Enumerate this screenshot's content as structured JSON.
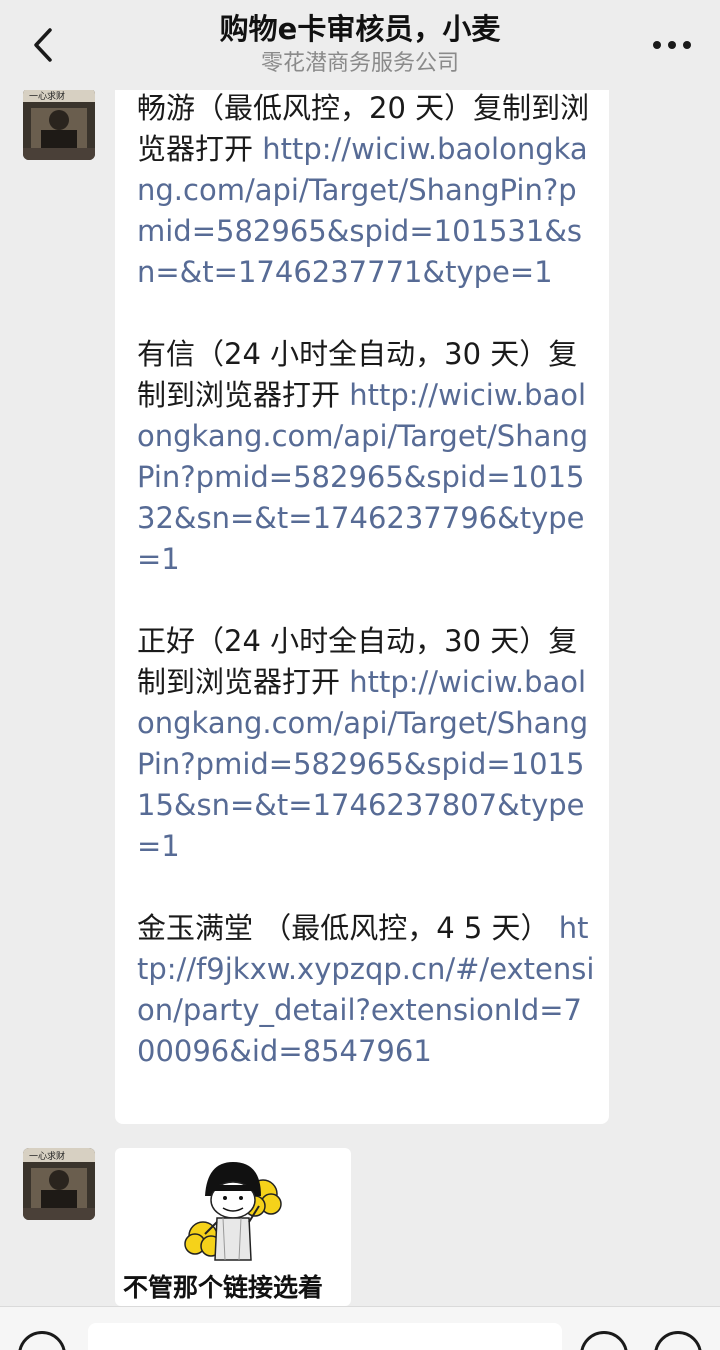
{
  "header": {
    "title": "购物e卡审核员，小麦",
    "subtitle": "零花潜商务服务公司",
    "back_icon": "chevron-left-icon",
    "more_icon": "more-dots-icon"
  },
  "messages": [
    {
      "sender_avatar": "avatar",
      "paragraphs": [
        {
          "text": "畅游（最低风控，20 天）复制到浏览器打开",
          "link": "http://wiciw.baolongkang.com/api/Target/ShangPin?pmid=582965&spid=101531&sn=&t=1746237771&type=1"
        },
        {
          "text": "有信（24 小时全自动，30 天）复制到浏览器打开",
          "link": "http://wiciw.baolongkang.com/api/Target/ShangPin?pmid=582965&spid=101532&sn=&t=1746237796&type=1"
        },
        {
          "text": "正好（24 小时全自动，30 天）复制到浏览器打开",
          "link": "http://wiciw.baolongkang.com/api/Target/ShangPin?pmid=582965&spid=101515&sn=&t=1746237807&type=1"
        },
        {
          "text": "金玉满堂 （最低风控，4 5 天）",
          "link": "http://f9jkxw.xypzqp.cn/#/extension/party_detail?extensionId=700096&id=8547961"
        }
      ]
    },
    {
      "sender_avatar": "avatar",
      "sticker_caption": "不管那个链接选着"
    }
  ],
  "input_bar": {
    "voice_icon": "voice-icon",
    "emoji_icon": "emoji-icon",
    "plus_icon": "plus-icon"
  },
  "colors": {
    "background": "#ededed",
    "bubble": "#ffffff",
    "link": "#576b95",
    "text": "#1a1a1a",
    "subtitle": "#8a8a8a"
  }
}
